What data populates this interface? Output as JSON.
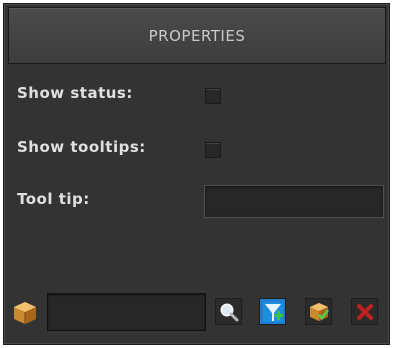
{
  "panel": {
    "title": "PROPERTIES",
    "show_status_label": "Show status:",
    "show_tooltips_label": "Show tooltips:",
    "tool_tip_label": "Tool tip:",
    "show_status_checked": false,
    "show_tooltips_checked": false,
    "tool_tip_value": ""
  },
  "toolbar": {
    "name_value": "",
    "icons": [
      "package-icon",
      "search-icon",
      "component-add-icon",
      "package-check-icon",
      "remove-icon"
    ]
  },
  "colors": {
    "background": "#333333",
    "header": "#444444",
    "text": "#e0e0e0",
    "field": "#272727"
  }
}
